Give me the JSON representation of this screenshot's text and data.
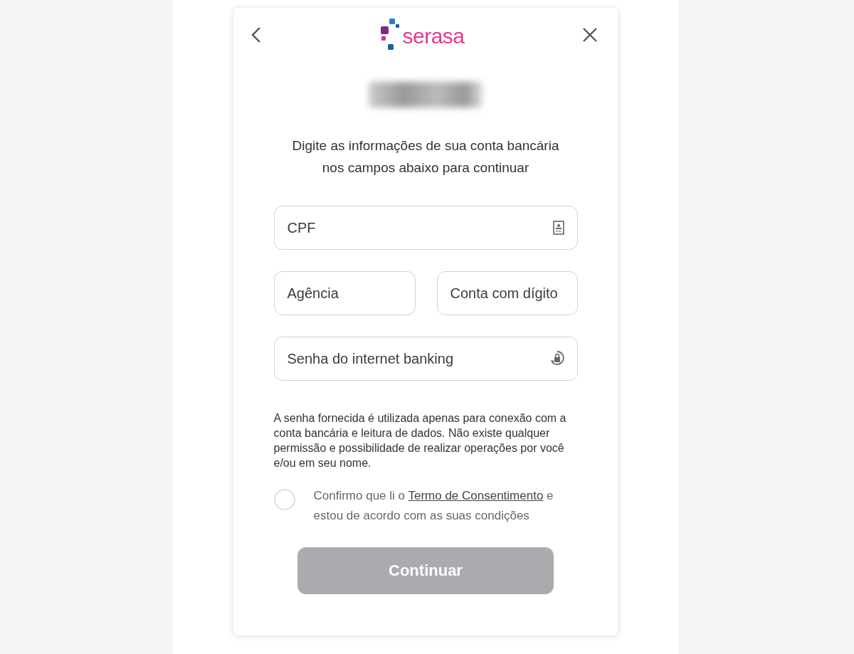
{
  "header": {
    "logo": "serasa"
  },
  "intro": "Digite as informações de sua conta bancária nos campos abaixo para continuar",
  "fields": [
    {
      "placeholder": "CPF",
      "kind": "id"
    },
    {
      "placeholder": "Agência",
      "kind": "plain"
    },
    {
      "placeholder": "Conta com dígito",
      "kind": "plain"
    },
    {
      "placeholder": "Senha do internet banking",
      "kind": "password"
    }
  ],
  "disclaimer": "A senha fornecida é utilizada apenas para conexão com a conta bancária e leitura de dados. Não existe qualquer permissão e possibilidade de realizar operações por você e/ou em seu nome.",
  "consent": {
    "checked": false,
    "before": "Confirmo que li o",
    "link": "Termo de Consentimento",
    "after": "e estou de acordo com as suas condições"
  },
  "button": {
    "label": "Continuar",
    "disabled": true
  }
}
